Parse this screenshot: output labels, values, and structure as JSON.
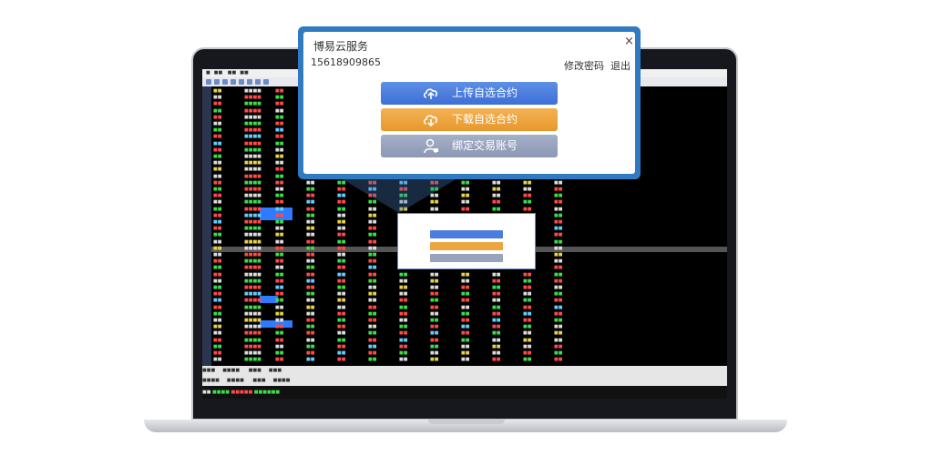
{
  "dialog": {
    "title": "博易云服务",
    "close": "×",
    "phone": "15618909865",
    "change_password": "修改密码",
    "logout": "退出",
    "upload_label": "上传自选合约",
    "download_label": "下载自选合约",
    "bind_label": "绑定交易账号"
  },
  "colors": {
    "dialog_frame": "#2f7ac0",
    "upload": "#4a7ddf",
    "download": "#eda540",
    "bind": "#98a3bd"
  },
  "icons": [
    "cloud-upload-icon",
    "cloud-download-icon",
    "user-bind-icon",
    "close-icon"
  ]
}
